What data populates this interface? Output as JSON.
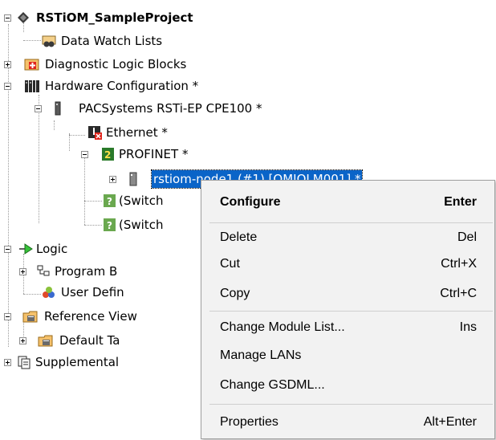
{
  "tree": {
    "root": "RSTiOM_SampleProject",
    "data_watch_lists": "Data Watch Lists",
    "diagnostic_logic_blocks": "Diagnostic Logic Blocks",
    "hardware_configuration": "Hardware Configuration *",
    "cpu": "PACSystems RSTi-EP CPE100 *",
    "ethernet": "Ethernet *",
    "profinet": "PROFINET *",
    "node": "rstiom-node1 (#1) [OMIOLM001] *",
    "switch1": "(Switch",
    "switch2": "(Switch",
    "logic": "Logic",
    "program_blocks": "Program B",
    "user_defined": "User Defin",
    "reference_view": "Reference View",
    "default_tables": "Default Ta",
    "supplemental": "Supplemental"
  },
  "context_menu": {
    "items": [
      {
        "label": "Configure",
        "shortcut": "Enter"
      },
      {
        "label": "Delete",
        "shortcut": "Del"
      },
      {
        "label": "Cut",
        "shortcut": "Ctrl+X"
      },
      {
        "label": "Copy",
        "shortcut": "Ctrl+C"
      },
      {
        "label": "Change Module List...",
        "shortcut": "Ins"
      },
      {
        "label": "Manage LANs",
        "shortcut": ""
      },
      {
        "label": "Change GSDML...",
        "shortcut": ""
      },
      {
        "label": "Properties",
        "shortcut": "Alt+Enter"
      }
    ]
  },
  "colors": {
    "selection": "#0a64c8",
    "menu_background": "#f2f2f2"
  }
}
